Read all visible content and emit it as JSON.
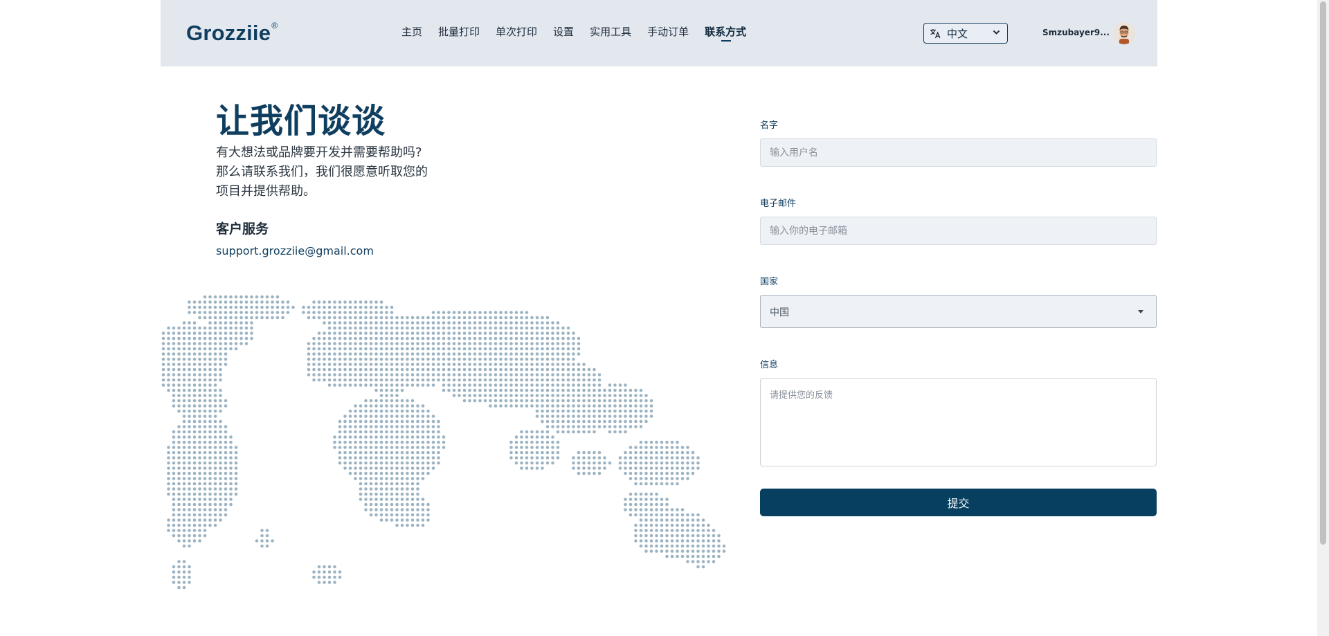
{
  "brand": {
    "name": "Grozziie",
    "mark": "®"
  },
  "nav": {
    "items": [
      {
        "label": "主页"
      },
      {
        "label": "批量打印"
      },
      {
        "label": "单次打印"
      },
      {
        "label": "设置"
      },
      {
        "label": "实用工具"
      },
      {
        "label": "手动订单"
      },
      {
        "label": "联系方式"
      }
    ],
    "active": "联系方式"
  },
  "language": {
    "icon": "translate-icon",
    "selected": "中文"
  },
  "user": {
    "name": "Smzubayer9..."
  },
  "hero": {
    "title": "让我们谈谈",
    "intro": [
      "有大想法或品牌要开发并需要帮助吗?",
      "那么请联系我们，我们很愿意听取您的",
      "项目并提供帮助。"
    ],
    "service_title": "客户服务",
    "service_email": "support.grozziie@gmail.com"
  },
  "form": {
    "name_label": "名字",
    "name_placeholder": "输入用户名",
    "email_label": "电子邮件",
    "email_placeholder": "输入你的电子邮箱",
    "country_label": "国家",
    "country_value": "中国",
    "message_label": "信息",
    "message_placeholder": "请提供您的反馈",
    "submit_label": "提交"
  },
  "colors": {
    "primary": "#063f60",
    "header_bg": "#e3e8ef",
    "map_dots": "#9db3c2"
  }
}
